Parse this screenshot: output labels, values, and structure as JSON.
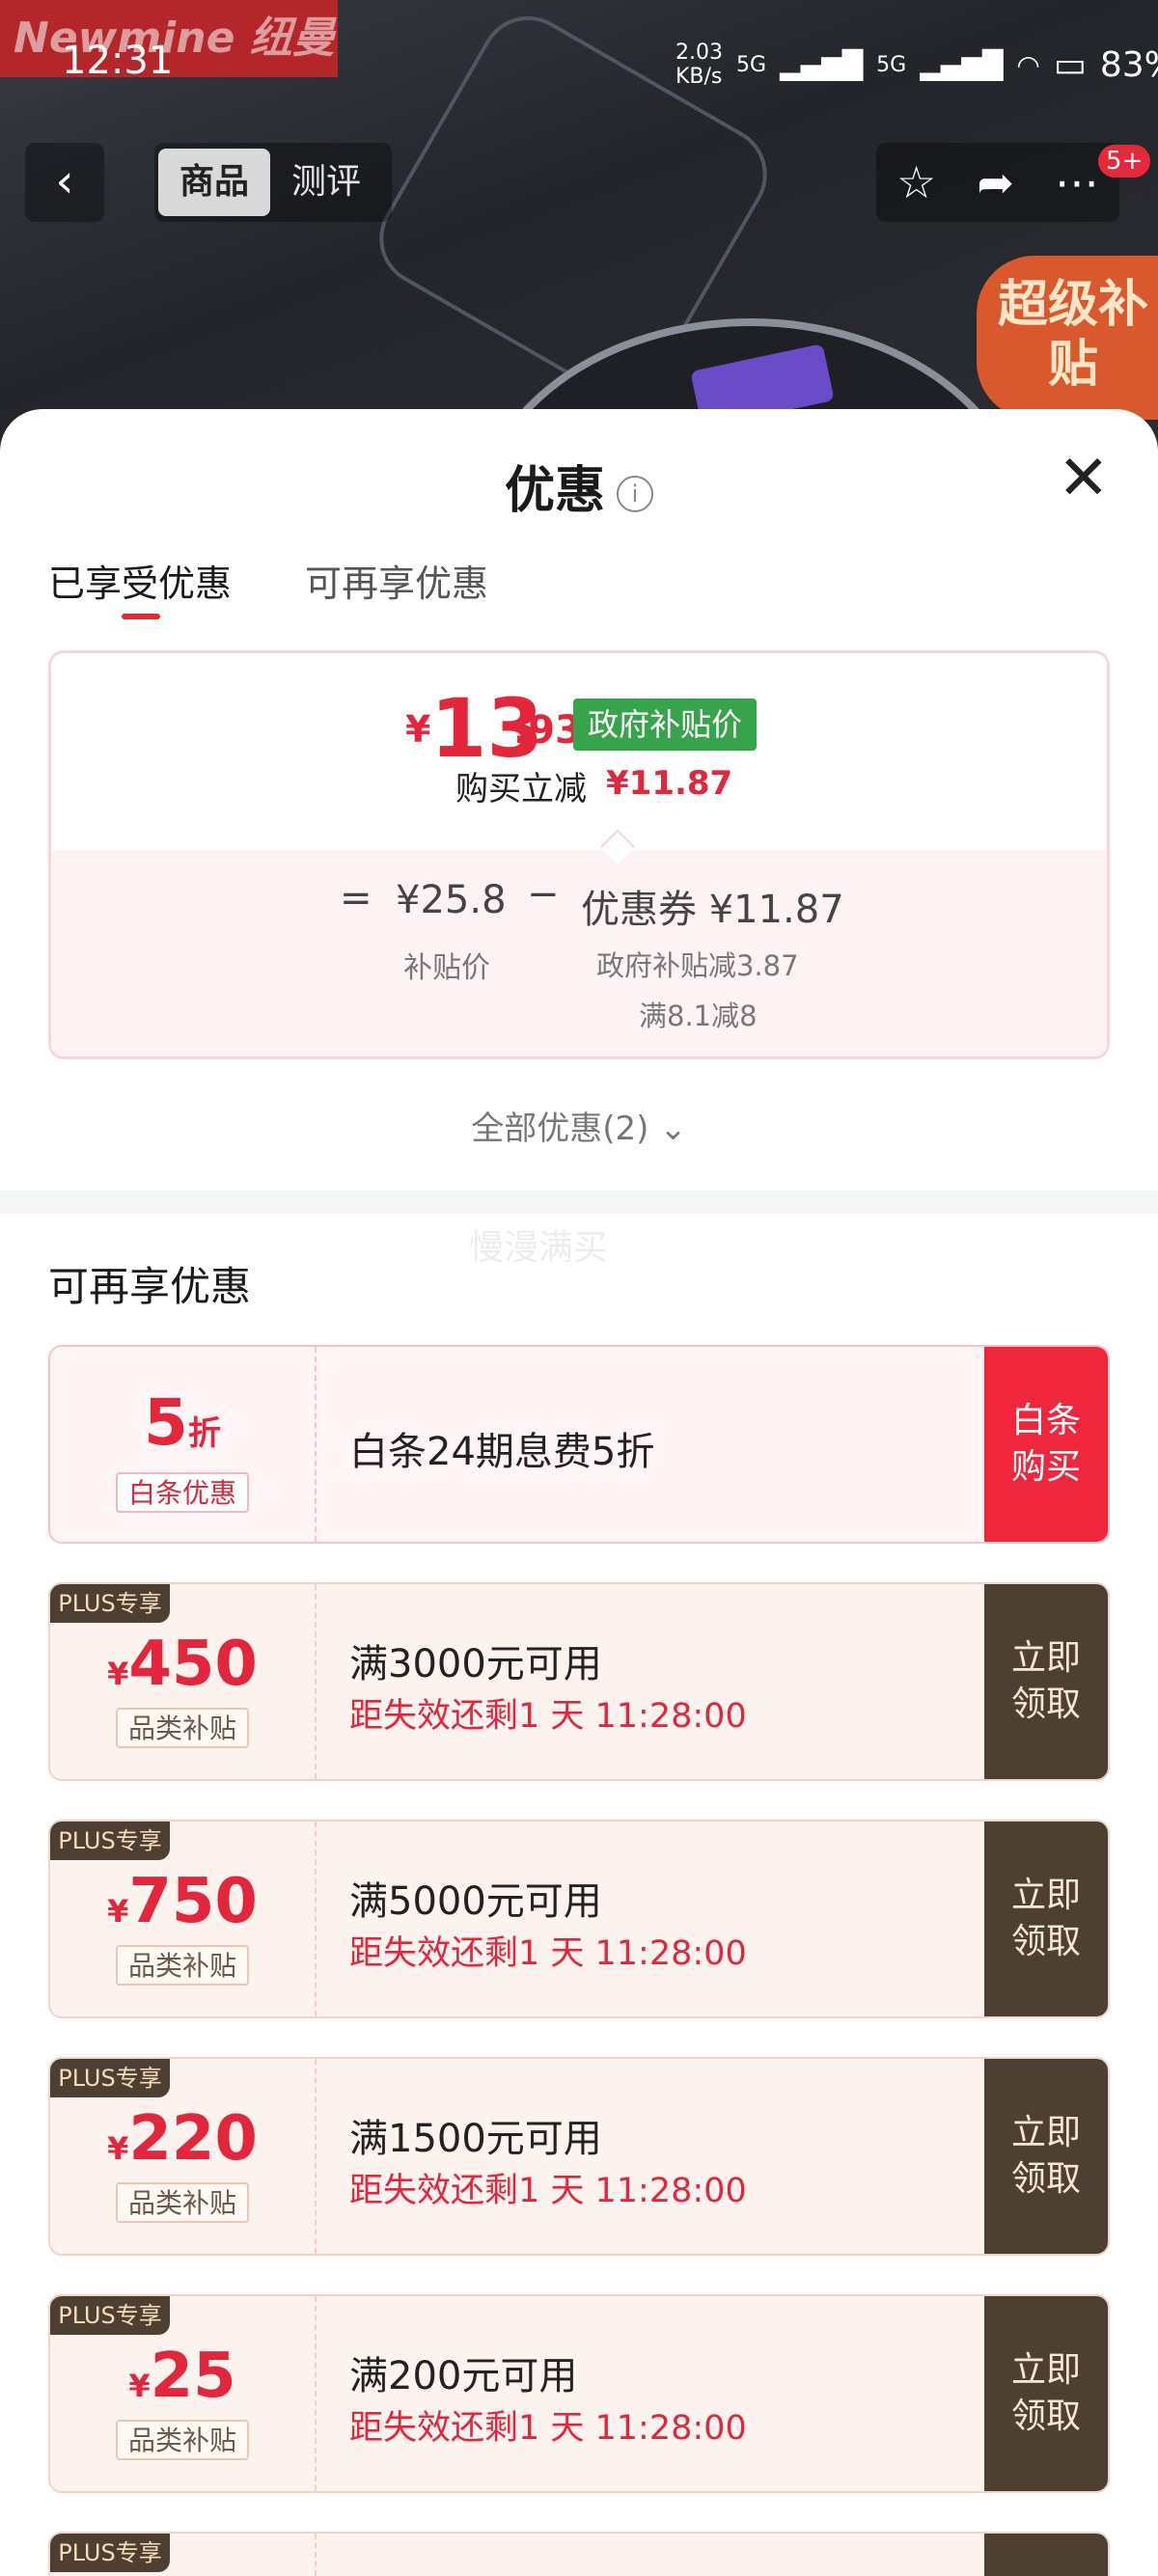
{
  "status_bar": {
    "time": "12:31",
    "net_speed": "2.03 KB/s",
    "signal1": "5G",
    "signal2": "5G",
    "battery": "83%"
  },
  "header": {
    "brand": "Newmine 纽曼",
    "tabs": [
      "商品",
      "测评"
    ],
    "badge": "5+",
    "subsidy_tag": "超级补贴"
  },
  "sheet": {
    "title": "优惠",
    "tabs": [
      "已享受优惠",
      "可再享优惠"
    ],
    "price": {
      "yen": "¥",
      "integer": "13",
      "decimal": ".93",
      "tag": "政府补贴价",
      "reduce_label": "购买立减",
      "reduce_value": "¥11.87"
    },
    "calc": {
      "eq": "=",
      "base_value": "¥25.8",
      "base_label": "补贴价",
      "minus": "−",
      "coupon_value": "优惠券 ¥11.87",
      "gov_reduce": "政府补贴减3.87",
      "full_reduce": "满8.1减8"
    },
    "all_discounts": "全部优惠(2) ⌄",
    "watermark": "慢漫满买",
    "more_title": "可再享优惠"
  },
  "coupons": [
    {
      "kind": "red",
      "amount_main": "5",
      "amount_unit": "折",
      "tag": "白条优惠",
      "title": "白条24期息费5折",
      "expiry": "",
      "action": "白条\n购买"
    },
    {
      "kind": "plus",
      "plus": "PLUS专享",
      "amount_yen": "¥",
      "amount_main": "450",
      "tag": "品类补贴",
      "title": "满3000元可用",
      "expiry": "距失效还剩1 天 11:28:00",
      "action": "立即\n领取"
    },
    {
      "kind": "plus",
      "plus": "PLUS专享",
      "amount_yen": "¥",
      "amount_main": "750",
      "tag": "品类补贴",
      "title": "满5000元可用",
      "expiry": "距失效还剩1 天 11:28:00",
      "action": "立即\n领取"
    },
    {
      "kind": "plus",
      "plus": "PLUS专享",
      "amount_yen": "¥",
      "amount_main": "220",
      "tag": "品类补贴",
      "title": "满1500元可用",
      "expiry": "距失效还剩1 天 11:28:00",
      "action": "立即\n领取"
    },
    {
      "kind": "plus",
      "plus": "PLUS专享",
      "amount_yen": "¥",
      "amount_main": "25",
      "tag": "品类补贴",
      "title": "满200元可用",
      "expiry": "距失效还剩1 天 11:28:00",
      "action": "立即\n领取"
    },
    {
      "kind": "plus",
      "plus": "PLUS专享"
    }
  ]
}
